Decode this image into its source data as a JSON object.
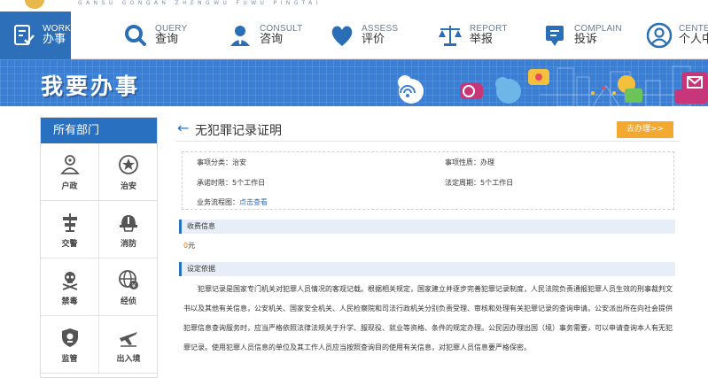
{
  "topbar": {
    "pinyin": "GANSU GONGAN ZHENGWU FUWU PINGTAI"
  },
  "nav": {
    "items": [
      {
        "en": "WORK",
        "cn": "办事",
        "icon": "work-icon"
      },
      {
        "en": "QUERY",
        "cn": "查询",
        "icon": "search-icon"
      },
      {
        "en": "CONSULT",
        "cn": "咨询",
        "icon": "consult-icon"
      },
      {
        "en": "ASSESS",
        "cn": "评价",
        "icon": "heart-icon"
      },
      {
        "en": "REPORT",
        "cn": "举报",
        "icon": "scale-icon"
      },
      {
        "en": "COMPLAIN",
        "cn": "投诉",
        "icon": "complain-icon"
      },
      {
        "en": "CENTER",
        "cn": "个人中",
        "icon": "user-icon"
      }
    ]
  },
  "banner": {
    "title": "我要办事"
  },
  "sidebar": {
    "title": "所有部门",
    "categories": [
      {
        "label": "户政",
        "icon": "household-icon"
      },
      {
        "label": "治安",
        "icon": "badge-icon"
      },
      {
        "label": "交警",
        "icon": "traffic-icon"
      },
      {
        "label": "消防",
        "icon": "helmet-icon"
      },
      {
        "label": "禁毒",
        "icon": "skull-icon"
      },
      {
        "label": "经侦",
        "icon": "globe-icon"
      },
      {
        "label": "监管",
        "icon": "shield-icon"
      },
      {
        "label": "出入境",
        "icon": "plane-icon"
      }
    ]
  },
  "main": {
    "title": "无犯罪记录证明",
    "go_button": "去办理>>",
    "info": {
      "category": "事项分类：治安",
      "nature": "事项性质：办理",
      "promise_time": "承诺时限：5个工作日",
      "legal_time": "法定周期：5个工作日",
      "flow_label": "业务流程图：",
      "flow_link": "点击查看"
    },
    "fee_header": "收费信息",
    "fee_value": "0",
    "fee_unit": "元",
    "basis_header": "设定依据",
    "basis_text": "犯罪记录是国家专门机关对犯罪人员情况的客观记载。根据相关规定，国家建立并逐步完善犯罪记录制度，人民法院负责通报犯罪人员生效的刑事裁判文书以及其他有关信息，公安机关、国家安全机关、人民检察院和司法行政机关分别负责受理、审核和处理有关犯罪记录的查询申请。公安派出所在向社会提供犯罪信息查询服务时，应当严格依照法律法规关于升学、服现役、就业等资格、条件的规定办理。公民因办理出国（境）事务需要，可以申请查询本人有无犯罪记录。使用犯罪人员信息的单位及其工作人员应当按照查询目的使用有关信息，对犯罪人员信息要严格保密。"
  },
  "colors": {
    "primary": "#2a70c1",
    "banner": "#3b7fd4",
    "accent": "#f3a830",
    "fee_number": "#e8751a"
  }
}
